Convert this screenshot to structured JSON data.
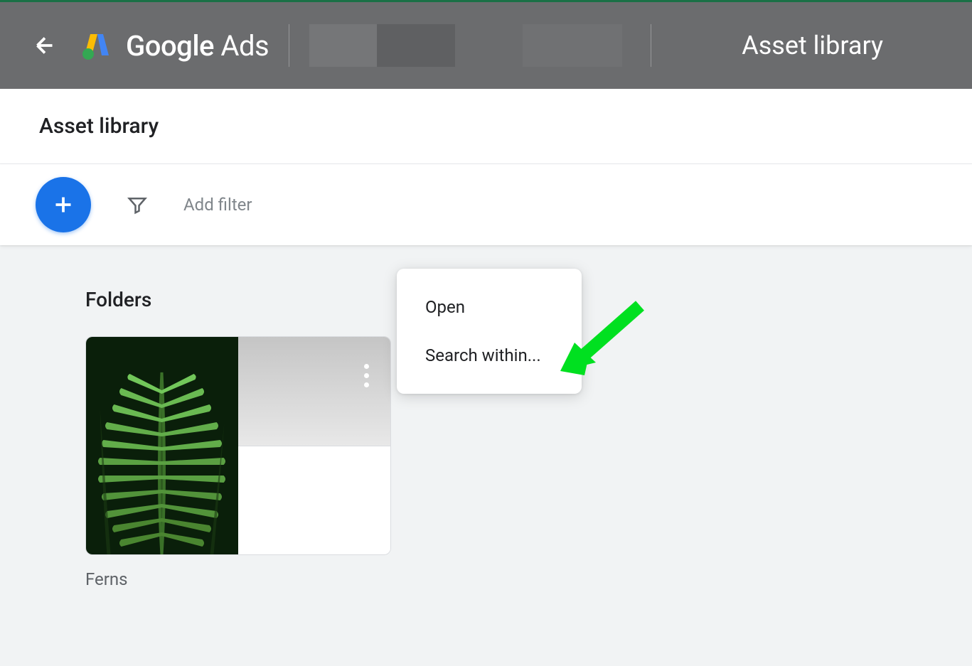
{
  "header": {
    "product_name_bold": "Google",
    "product_name_regular": " Ads",
    "title_right": "Asset library"
  },
  "page": {
    "title": "Asset library"
  },
  "toolbar": {
    "filter_placeholder": "Add filter"
  },
  "sections": {
    "folders": {
      "heading": "Folders",
      "items": [
        {
          "label": "Ferns"
        }
      ]
    }
  },
  "context_menu": {
    "open": "Open",
    "search_within": "Search within..."
  }
}
